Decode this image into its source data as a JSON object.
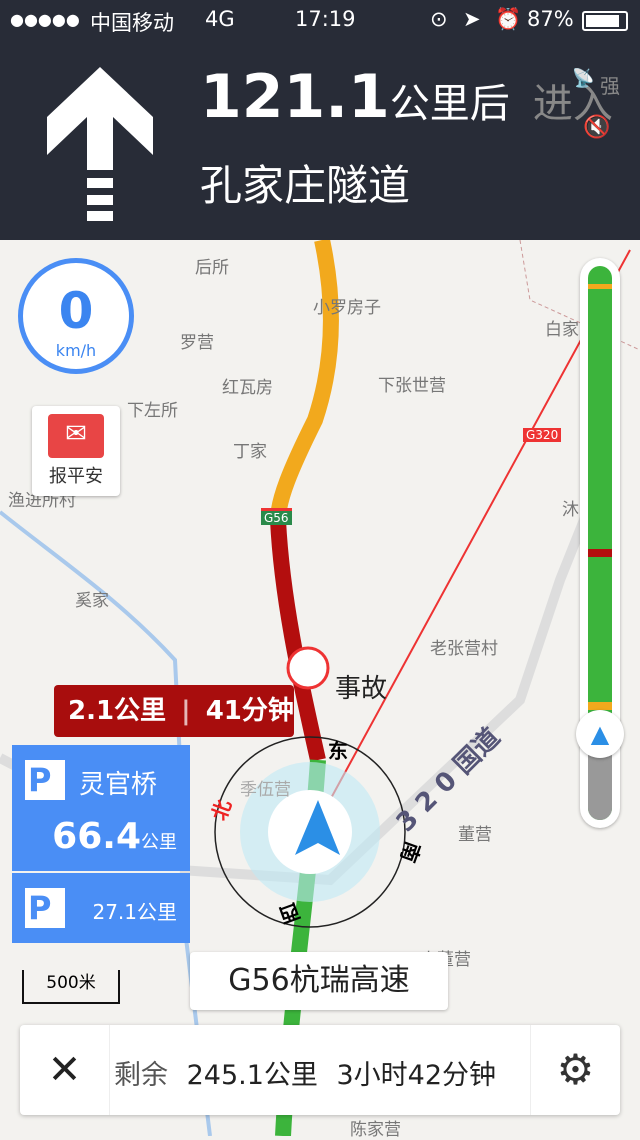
{
  "status_bar": {
    "signal": "●●●●●",
    "carrier": "中国移动",
    "network": "4G",
    "time": "17:19",
    "battery": "87%"
  },
  "guidance": {
    "distance": "121.1",
    "distance_unit": "公里后",
    "action": "进入",
    "road": "孔家庄隧道",
    "gps_strength": "强",
    "icons": [
      "straight-arrow-icon",
      "gps-signal-icon",
      "mute-icon"
    ]
  },
  "speed": {
    "value": "0",
    "unit": "km/h"
  },
  "report_safe": {
    "label": "报平安"
  },
  "incident": {
    "label": "事故",
    "distance": "2.1公里",
    "time": "41分钟"
  },
  "compass": {
    "east": "东",
    "west": "西",
    "south": "南",
    "north": "北"
  },
  "service_areas": [
    {
      "name": "灵官桥",
      "distance": "66.4",
      "unit": "公里"
    },
    {
      "distance": "27.1公里"
    }
  ],
  "scale": {
    "label": "500米"
  },
  "current_road": "G56杭瑞高速",
  "map_labels": {
    "houso": "后所",
    "xiaoluo": "小罗房子",
    "baijia": "白家",
    "luoying": "罗营",
    "hongwa": "红瓦房",
    "xiazhang": "下张世营",
    "xiazuo": "下左所",
    "dingjia": "丁家",
    "g320": "G320",
    "yujin": "渔进所村",
    "mu": "沐",
    "g56": "G56",
    "xijia": "奚家",
    "laozhang": "老张营村",
    "jiwu": "季伍营",
    "dongying": "董营",
    "xiaodong": "小董营",
    "chenjia": "陈家营",
    "road320": "3 2 0 国道"
  },
  "route_colors": {
    "slow": "#f2a91d",
    "congested": "#b30e0e",
    "clear": "#3cb43c"
  },
  "bottom_bar": {
    "remaining_label": "剩余",
    "remaining_distance": "245.1公里",
    "remaining_time": "3小时42分钟"
  }
}
